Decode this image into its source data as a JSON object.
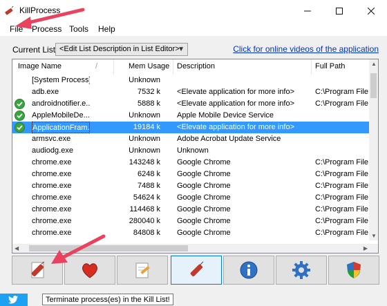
{
  "window": {
    "title": "KillProcess"
  },
  "menu": [
    "File",
    "Process",
    "Tools",
    "Help"
  ],
  "toolbar": {
    "current_list_label": "Current List:",
    "current_list_value": "<Edit List Description in List Editor>",
    "online_link": "Click for online videos of the application"
  },
  "columns": [
    "Image Name",
    "Mem Usage",
    "Description",
    "Full Path"
  ],
  "rows": [
    {
      "name": "[System Process]",
      "mem": "Unknown",
      "desc": "",
      "path": "",
      "checked": false,
      "selected": false
    },
    {
      "name": "adb.exe",
      "mem": "7532 k",
      "desc": "<Elevate application for more info>",
      "path": "C:\\Program File",
      "checked": false,
      "selected": false
    },
    {
      "name": "androidnotifier.e...",
      "mem": "5888 k",
      "desc": "<Elevate application for more info>",
      "path": "C:\\Program File",
      "checked": true,
      "selected": false
    },
    {
      "name": "AppleMobileDe...",
      "mem": "Unknown",
      "desc": "Apple Mobile Device Service",
      "path": "",
      "checked": true,
      "selected": false
    },
    {
      "name": "ApplicationFram...",
      "mem": "19184 k",
      "desc": "<Elevate application for more info>",
      "path": "",
      "checked": true,
      "selected": true
    },
    {
      "name": "armsvc.exe",
      "mem": "Unknown",
      "desc": "Adobe Acrobat Update Service",
      "path": "",
      "checked": false,
      "selected": false
    },
    {
      "name": "audiodg.exe",
      "mem": "Unknown",
      "desc": "Unknown",
      "path": "",
      "checked": false,
      "selected": false
    },
    {
      "name": "chrome.exe",
      "mem": "143248 k",
      "desc": "Google Chrome",
      "path": "C:\\Program File",
      "checked": false,
      "selected": false
    },
    {
      "name": "chrome.exe",
      "mem": "6248 k",
      "desc": "Google Chrome",
      "path": "C:\\Program File",
      "checked": false,
      "selected": false
    },
    {
      "name": "chrome.exe",
      "mem": "7488 k",
      "desc": "Google Chrome",
      "path": "C:\\Program File",
      "checked": false,
      "selected": false
    },
    {
      "name": "chrome.exe",
      "mem": "54624 k",
      "desc": "Google Chrome",
      "path": "C:\\Program File",
      "checked": false,
      "selected": false
    },
    {
      "name": "chrome.exe",
      "mem": "114468 k",
      "desc": "Google Chrome",
      "path": "C:\\Program File",
      "checked": false,
      "selected": false
    },
    {
      "name": "chrome.exe",
      "mem": "280040 k",
      "desc": "Google Chrome",
      "path": "C:\\Program File",
      "checked": false,
      "selected": false
    },
    {
      "name": "chrome.exe",
      "mem": "84808 k",
      "desc": "Google Chrome",
      "path": "C:\\Program File",
      "checked": false,
      "selected": false
    }
  ],
  "buttons": [
    {
      "name": "kill-list-button",
      "icon": "dynamite-doc-icon",
      "active": false
    },
    {
      "name": "favorites-button",
      "icon": "heart-icon",
      "active": false
    },
    {
      "name": "list-editor-button",
      "icon": "pen-doc-icon",
      "active": false
    },
    {
      "name": "kill-button",
      "icon": "dynamite-icon",
      "active": true
    },
    {
      "name": "info-button",
      "icon": "info-icon",
      "active": false
    },
    {
      "name": "settings-button",
      "icon": "gear-icon",
      "active": false
    },
    {
      "name": "elevate-button",
      "icon": "shield-icon",
      "active": false
    }
  ],
  "tooltip": "Terminate process(es) in the Kill List!",
  "colors": {
    "selection": "#3399ff",
    "accent": "#0078d7",
    "annotation_arrow": "#e8425f"
  }
}
